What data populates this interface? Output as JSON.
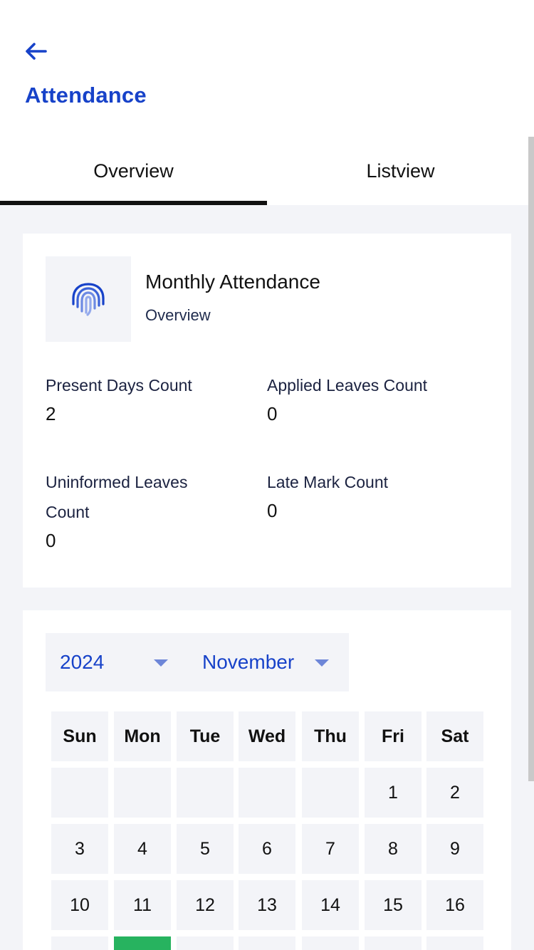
{
  "header": {
    "back_icon": "arrow-left-icon",
    "title": "Attendance",
    "accent_color": "#1742c9"
  },
  "tabs": [
    {
      "label": "Overview",
      "active": true
    },
    {
      "label": "Listview",
      "active": false
    }
  ],
  "summary": {
    "icon": "fingerprint-icon",
    "title": "Monthly Attendance",
    "subtitle": "Overview",
    "stats": [
      {
        "label": "Present Days Count",
        "value": "2"
      },
      {
        "label": "Applied Leaves Count",
        "value": "0"
      },
      {
        "label": "Uninformed Leaves Count",
        "value": "0"
      },
      {
        "label": "Late Mark Count",
        "value": "0"
      }
    ]
  },
  "calendar": {
    "year": "2024",
    "month": "November",
    "weekdays": [
      "Sun",
      "Mon",
      "Tue",
      "Wed",
      "Thu",
      "Fri",
      "Sat"
    ],
    "weeks": [
      [
        "",
        "",
        "",
        "",
        "",
        "1",
        "2"
      ],
      [
        "3",
        "4",
        "5",
        "6",
        "7",
        "8",
        "9"
      ],
      [
        "10",
        "11",
        "12",
        "13",
        "14",
        "15",
        "16"
      ],
      [
        "",
        "",
        "",
        "",
        "",
        "",
        ""
      ]
    ],
    "present_color": "#27b35f",
    "present_cell": {
      "week": 3,
      "weekday": 1
    }
  }
}
